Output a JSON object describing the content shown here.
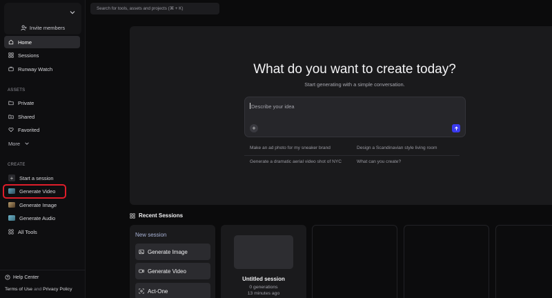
{
  "sidebar": {
    "invite_label": "Invite members",
    "nav": [
      {
        "label": "Home",
        "icon": "home-icon",
        "active": true
      },
      {
        "label": "Sessions",
        "icon": "grid-icon",
        "active": false
      },
      {
        "label": "Runway Watch",
        "icon": "tv-icon",
        "active": false
      }
    ],
    "assets_label": "ASSETS",
    "assets": [
      {
        "label": "Private",
        "icon": "folder-icon"
      },
      {
        "label": "Shared",
        "icon": "folder-shared-icon"
      },
      {
        "label": "Favorited",
        "icon": "heart-icon"
      }
    ],
    "more_label": "More",
    "create_label": "CREATE",
    "create": [
      {
        "label": "Start a session",
        "icon": "plus-icon"
      },
      {
        "label": "Generate Video",
        "icon": "video-thumb-icon"
      },
      {
        "label": "Generate Image",
        "icon": "image-thumb-icon"
      },
      {
        "label": "Generate Audio",
        "icon": "audio-thumb-icon"
      },
      {
        "label": "All Tools",
        "icon": "apps-grid-icon"
      }
    ],
    "help_label": "Help Center",
    "terms_label": "Terms of Use",
    "and_label": "and",
    "privacy_label": "Privacy Policy"
  },
  "search": {
    "placeholder": "Search for tools, assets and projects (⌘ + K)"
  },
  "hero": {
    "title": "What do you want to create today?",
    "subtitle": "Start generating with a simple conversation.",
    "prompt_placeholder": "Describe your idea",
    "suggestions": [
      "Make an ad photo for my sneaker brand",
      "Design a Scandinavian style living room",
      "Generate a dramatic aerial video shot of NYC",
      "What can you create?"
    ]
  },
  "recent": {
    "heading": "Recent Sessions",
    "new_session_title": "New session",
    "new_session_buttons": [
      {
        "label": "Generate Image",
        "icon": "image-icon"
      },
      {
        "label": "Generate Video",
        "icon": "video-icon"
      },
      {
        "label": "Act-One",
        "icon": "act-one-icon"
      }
    ],
    "session": {
      "name": "Untitled session",
      "generations": "0 generations",
      "updated": "13 minutes ago"
    }
  },
  "colors": {
    "accent_send": "#3b3bf0",
    "highlight_box": "#e11d2a",
    "background": "#0b0b0c",
    "panel": "#1a1a1c"
  }
}
